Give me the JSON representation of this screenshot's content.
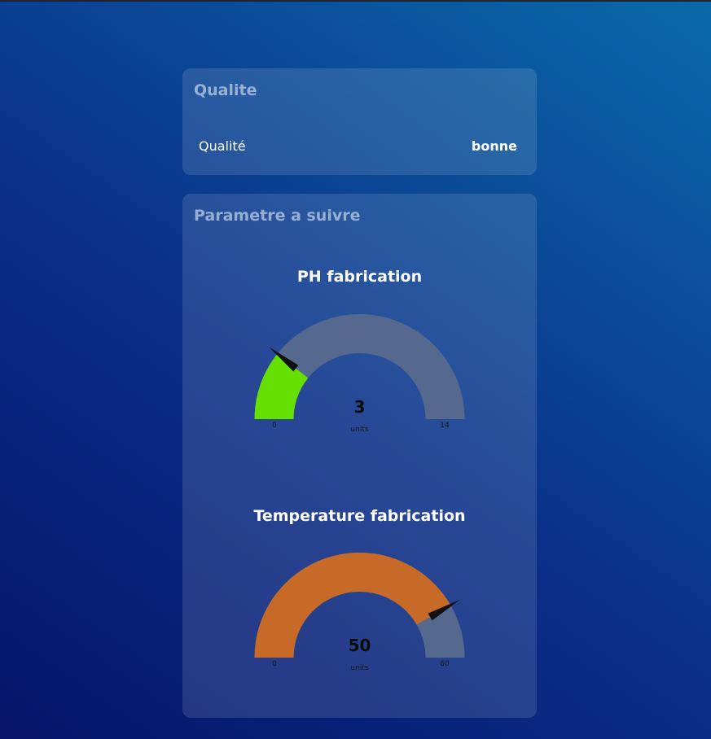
{
  "quality_card": {
    "title": "Qualite",
    "row_label": "Qualité",
    "row_value": "bonne"
  },
  "params_card": {
    "title": "Parametre a suivre"
  },
  "gauges": [
    {
      "title": "PH fabrication",
      "value": 3,
      "value_text": "3",
      "units": "units",
      "min": 0,
      "max": 14,
      "min_label": "0",
      "max_label": "14",
      "fill_color": "#66e003",
      "track_color": "#54698d"
    },
    {
      "title": "Temperature fabrication",
      "value": 50,
      "value_text": "50",
      "units": "units",
      "min": 0,
      "max": 60,
      "min_label": "0",
      "max_label": "60",
      "fill_color": "#c76a28",
      "track_color": "#54698d"
    }
  ],
  "needle_color": "#111111"
}
